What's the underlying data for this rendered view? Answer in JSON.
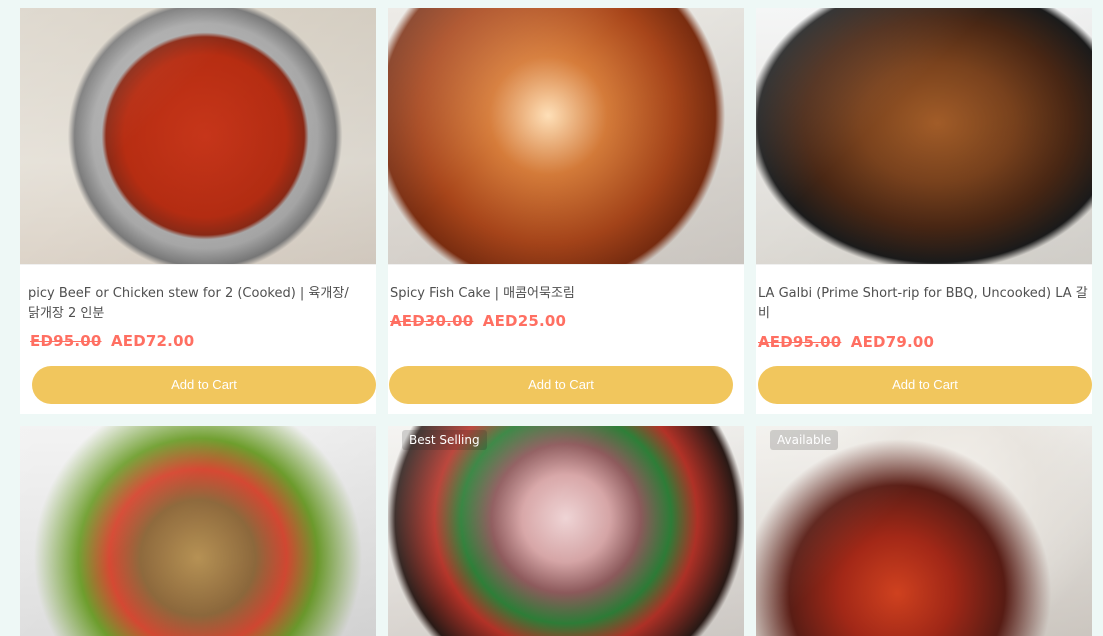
{
  "products": [
    {
      "name": "picy BeeF or Chicken stew for 2 (Cooked) | 육개장/닭개장 2 인분",
      "old_price": "ED95.00",
      "new_price": "AED72.00",
      "button": "Add to Cart"
    },
    {
      "name": "Spicy Fish Cake | 매콤어묵조림",
      "old_price": "AED30.00",
      "new_price": "AED25.00",
      "button": "Add to Cart"
    },
    {
      "name": "LA Galbi (Prime Short-rip for BBQ, Uncooked) LA 갈비",
      "old_price": "AED95.00",
      "new_price": "AED79.00",
      "button": "Add to Cart"
    },
    {
      "name": "",
      "old_price": "",
      "new_price": "",
      "button": ""
    },
    {
      "badge": "Best Selling",
      "name": "",
      "old_price": "",
      "new_price": "",
      "button": ""
    },
    {
      "badge": "Available",
      "name": "",
      "old_price": "",
      "new_price": "",
      "button": ""
    }
  ],
  "colors": {
    "background": "#eef8f6",
    "button": "#f1c65d",
    "price": "#ff6f62",
    "text": "#4f4f4f"
  }
}
